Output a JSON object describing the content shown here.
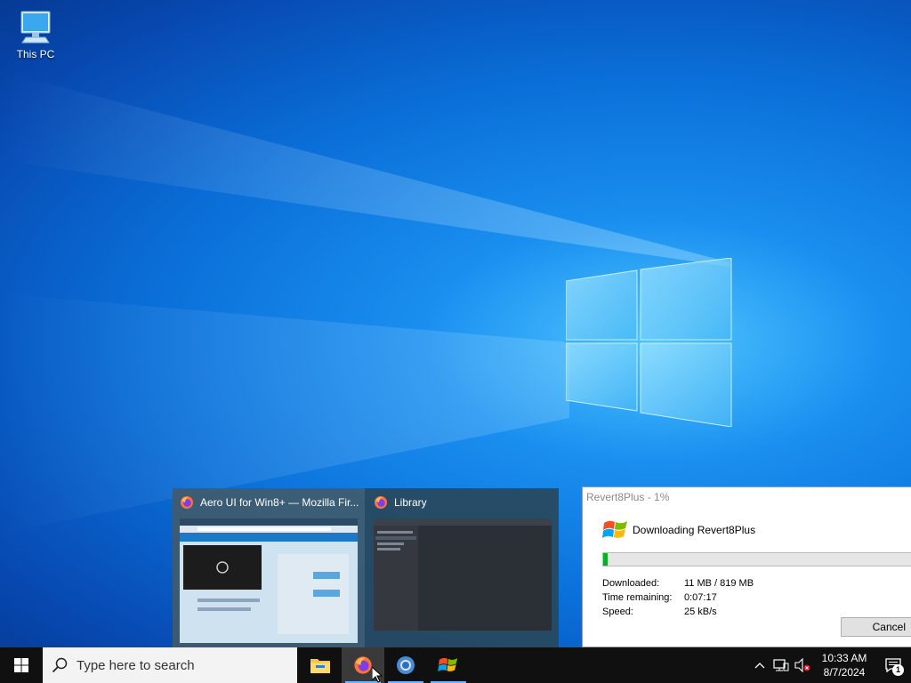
{
  "desktop": {
    "icons": [
      {
        "label": "This PC",
        "icon": "this-pc-icon"
      }
    ]
  },
  "preview": {
    "thumbnails": [
      {
        "title": "Aero UI for Win8+ — Mozilla Fir...",
        "icon": "firefox-icon"
      },
      {
        "title": "Library",
        "icon": "firefox-icon"
      }
    ]
  },
  "dialog": {
    "title": "Revert8Plus - 1%",
    "heading": "Downloading Revert8Plus",
    "progress_percent": 1,
    "rows": [
      {
        "label": "Downloaded:",
        "value": "11 MB / 819 MB"
      },
      {
        "label": "Time remaining:",
        "value": "0:07:17"
      },
      {
        "label": "Speed:",
        "value": "25 kB/s"
      }
    ],
    "cancel_label": "Cancel"
  },
  "taskbar": {
    "search_placeholder": "Type here to search",
    "apps": [
      "file-explorer-icon",
      "firefox-icon",
      "chrome-icon",
      "windows-flag-icon"
    ],
    "clock_time": "10:33 AM",
    "clock_date": "8/7/2024",
    "notification_count": "1"
  },
  "colors": {
    "progress_fill": "#06b025",
    "taskbar": "#101010"
  }
}
